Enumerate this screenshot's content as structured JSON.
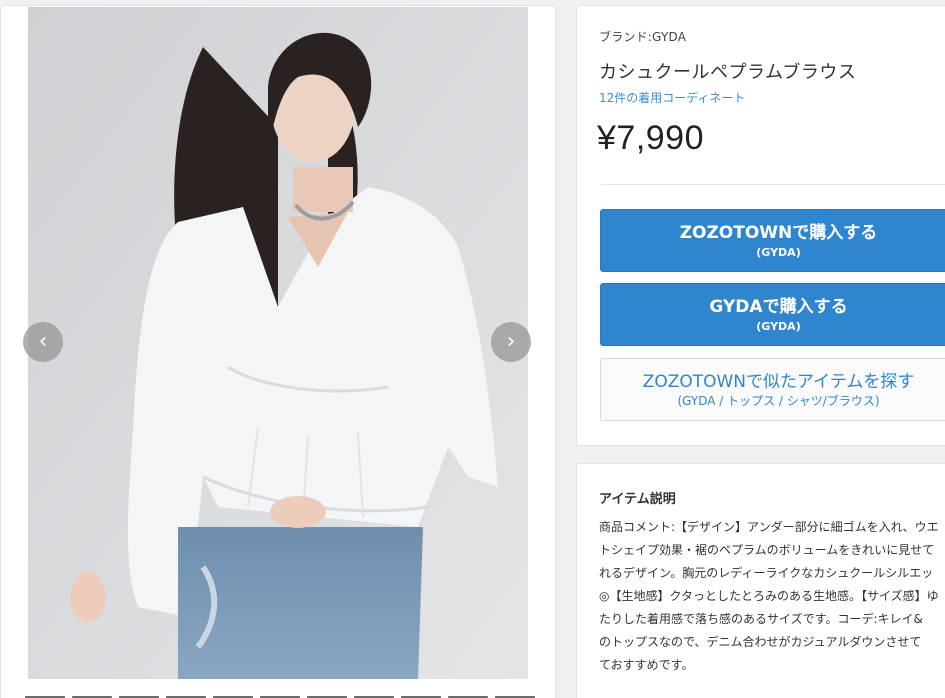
{
  "gallery": {
    "prev_icon": "chevron-left-icon",
    "next_icon": "chevron-right-icon",
    "prev_glyph": "‹",
    "next_glyph": "›",
    "thumbnail_count": 11
  },
  "product": {
    "brand_line": "ブランド:GYDA",
    "name": "カシュクールペプラムブラウス",
    "coordinate_link": "12件の着用コーディネート",
    "price": "¥7,990"
  },
  "actions": [
    {
      "main": "ZOZOTOWNで購入する",
      "sub": "(GYDA)",
      "style": "primary"
    },
    {
      "main": "GYDAで購入する",
      "sub": "(GYDA)",
      "style": "primary"
    },
    {
      "main": "ZOZOTOWNで似たアイテムを探す",
      "sub": "(GYDA / トップス / シャツ/ブラウス)",
      "style": "secondary"
    }
  ],
  "description": {
    "title": "アイテム説明",
    "lines": [
      "商品コメント:【デザイン】アンダー部分に細ゴムを入れ、ウエ",
      "トシェイプ効果・裾のペプラムのボリュームをきれいに見せて",
      "れるデザイン。胸元のレディーライクなカシュクールシルエッ",
      "◎【生地感】クタっとしたとろみのある生地感。【サイズ感】ゆ",
      "たりした着用感で落ち感のあるサイズです。コーデ:キレイ&",
      "のトップスなので、デニム合わせがカジュアルダウンさせて",
      "ておすすめです。"
    ]
  },
  "colors": {
    "accent": "#2f86cf",
    "background": "#eef0f2"
  }
}
